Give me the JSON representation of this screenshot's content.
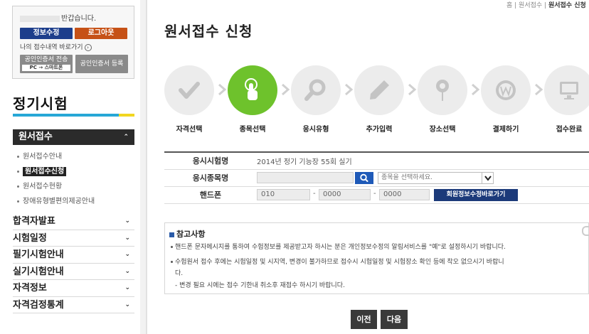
{
  "login": {
    "greeting": "반갑습니다.",
    "edit_info_label": "정보수정",
    "logout_label": "로그아웃",
    "my_history_label": "나의 접수내역 바로가기",
    "cert_send_label": "공인인증서 전송",
    "cert_send_sub": "PC → 스마트폰",
    "cert_register_label": "공인인증서 등록"
  },
  "sidebar": {
    "section_title": "정기시험",
    "active_menu": "원서접수",
    "submenu": [
      {
        "label": "원서접수안내",
        "active": false
      },
      {
        "label": "원서접수신청",
        "active": true
      },
      {
        "label": "원서접수현황",
        "active": false
      },
      {
        "label": "장애유형별편의제공안내",
        "active": false
      }
    ],
    "menus": [
      {
        "label": "합격자발표"
      },
      {
        "label": "시험일정"
      },
      {
        "label": "필기시험안내"
      },
      {
        "label": "실기시험안내"
      },
      {
        "label": "자격정보"
      },
      {
        "label": "자격검정통계"
      }
    ],
    "colors": {
      "bar_blue": "#27a7d6",
      "bar_yellow": "#f2d620"
    }
  },
  "breadcrumb": {
    "items": [
      "홈",
      "원서접수",
      "원서접수 신청"
    ]
  },
  "page": {
    "title": "원서접수 신청"
  },
  "steps": [
    {
      "label": "자격선택",
      "icon": "check-icon",
      "active": false
    },
    {
      "label": "종목선택",
      "icon": "touch-icon",
      "active": true
    },
    {
      "label": "응시유형",
      "icon": "magnifier-icon",
      "active": false
    },
    {
      "label": "추가입력",
      "icon": "pencil-icon",
      "active": false
    },
    {
      "label": "장소선택",
      "icon": "location-pin-icon",
      "active": false
    },
    {
      "label": "결제하기",
      "icon": "won-coin-icon",
      "active": false
    },
    {
      "label": "접수완료",
      "icon": "ok-monitor-icon",
      "active": false
    }
  ],
  "form": {
    "exam_name_label": "응시시험명",
    "exam_name_value": "2014년 정기 기능장 55회 실기",
    "subject_label": "응시종목명",
    "subject_placeholder": "종목을 선택하세요.",
    "phone_label": "핸드폰",
    "phone_1": "010",
    "phone_2": "0000",
    "phone_3": "0000",
    "phone_sep": "-",
    "member_info_label": "회원정보수정바로가기"
  },
  "notice": {
    "title": "참고사항",
    "lines": [
      "핸드폰 문자메시지를 통하여 수험정보를 제공받고자 하시는 분은 개인정보수정의 알림서비스를 \"예\"로 설정하시기 바랍니다.",
      "수험원서 접수 후에는 시험일정 및 시지역, 변경이 불가하므로 접수시 시험일정 및 시험장소 확인 등에 착오 없으시기 바랍니",
      "다.",
      "- 변경 필요 시에는 접수 기한내 취소후 재접수 하시기 바랍니다."
    ]
  },
  "buttons": {
    "prev_label": "이전",
    "next_label": "다음"
  },
  "colors": {
    "active_step": "#6ec22c",
    "inactive_step": "#ececec",
    "primary_blue": "#1d3e8c",
    "logout_orange": "#c65116"
  }
}
